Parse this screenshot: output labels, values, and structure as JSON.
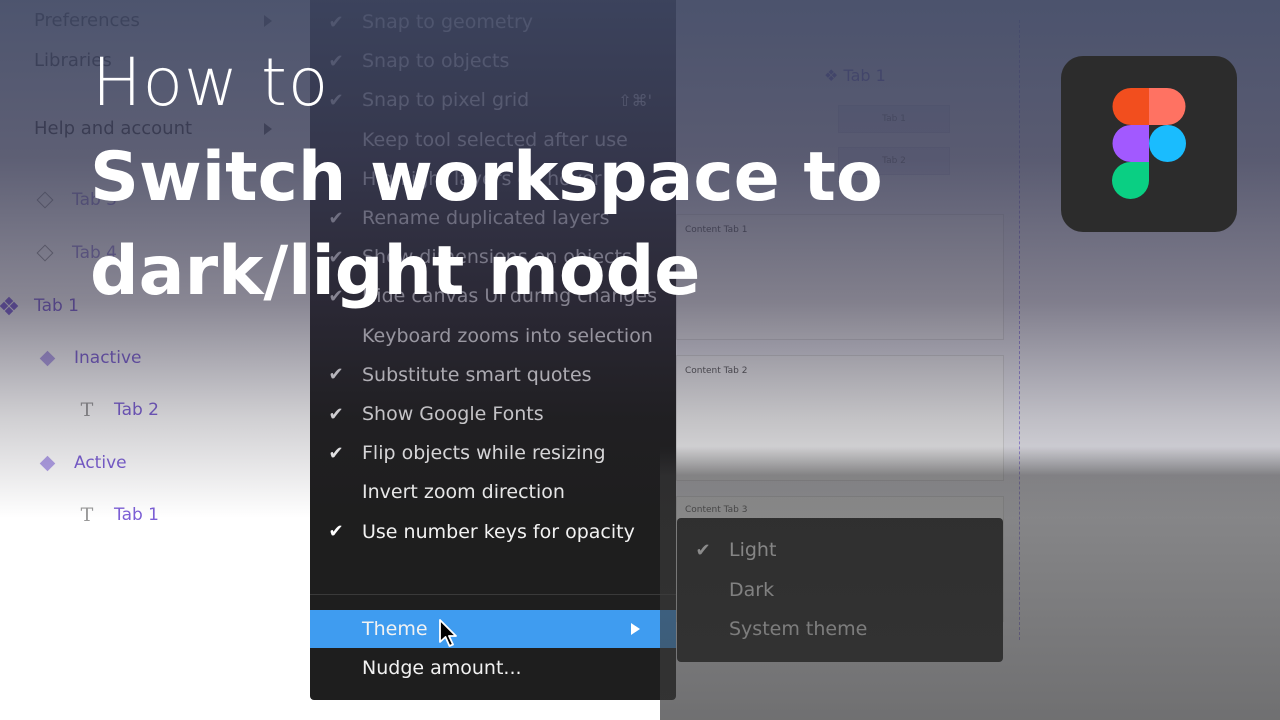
{
  "title": {
    "line0": "How to",
    "line1": "Switch workspace to",
    "line2": "dark/light mode"
  },
  "layers_panel": {
    "menu_items": [
      {
        "label": "Preferences",
        "has_submenu": true
      },
      {
        "label": "Libraries",
        "has_submenu": false
      },
      {
        "label": "Help and account",
        "has_submenu": true
      }
    ],
    "layers": [
      {
        "label": "Tab 3",
        "icon": "diamond-outline-icon"
      },
      {
        "label": "Tab 4",
        "icon": "diamond-outline-icon"
      },
      {
        "label": "Tab 1",
        "icon": "component-icon"
      },
      {
        "label": "Inactive",
        "icon": "diamond-icon"
      },
      {
        "label": "Tab 2",
        "icon": "text-icon"
      },
      {
        "label": "Active",
        "icon": "diamond-icon"
      },
      {
        "label": "Tab 1",
        "icon": "text-icon"
      }
    ]
  },
  "preferences_menu": {
    "items": [
      {
        "label": "Snap to geometry",
        "checked": true,
        "shortcut": ""
      },
      {
        "label": "Snap to objects",
        "checked": true,
        "shortcut": ""
      },
      {
        "label": "Snap to pixel grid",
        "checked": true,
        "shortcut": "⇧⌘'"
      },
      {
        "label": "Keep tool selected after use",
        "checked": false,
        "shortcut": ""
      },
      {
        "label": "Highlight layers on hover",
        "checked": true,
        "shortcut": ""
      },
      {
        "label": "Rename duplicated layers",
        "checked": true,
        "shortcut": ""
      },
      {
        "label": "Show dimensions on objects",
        "checked": true,
        "shortcut": ""
      },
      {
        "label": "Hide canvas UI during changes",
        "checked": true,
        "shortcut": ""
      },
      {
        "label": "Keyboard zooms into selection",
        "checked": false,
        "shortcut": ""
      },
      {
        "label": "Substitute smart quotes",
        "checked": true,
        "shortcut": ""
      },
      {
        "label": "Show Google Fonts",
        "checked": true,
        "shortcut": ""
      },
      {
        "label": "Flip objects while resizing",
        "checked": true,
        "shortcut": ""
      },
      {
        "label": "Invert zoom direction",
        "checked": false,
        "shortcut": ""
      },
      {
        "label": "Use number keys for opacity",
        "checked": true,
        "shortcut": ""
      }
    ],
    "theme_label": "Theme",
    "nudge_label": "Nudge amount..."
  },
  "theme_submenu": {
    "items": [
      {
        "label": "Light",
        "checked": true
      },
      {
        "label": "Dark",
        "checked": false
      },
      {
        "label": "System theme",
        "checked": false
      }
    ]
  },
  "canvas": {
    "component_label": "Tab 1",
    "tab_buttons": [
      "Tab 1",
      "Tab 2"
    ],
    "content_boxes": [
      "Content Tab 1",
      "Content Tab 2",
      "Content Tab 3"
    ]
  },
  "colors": {
    "accent": "#7c5fd6",
    "menu_highlight": "#3f9cf0",
    "menu_bg": "#1e1e1e"
  }
}
